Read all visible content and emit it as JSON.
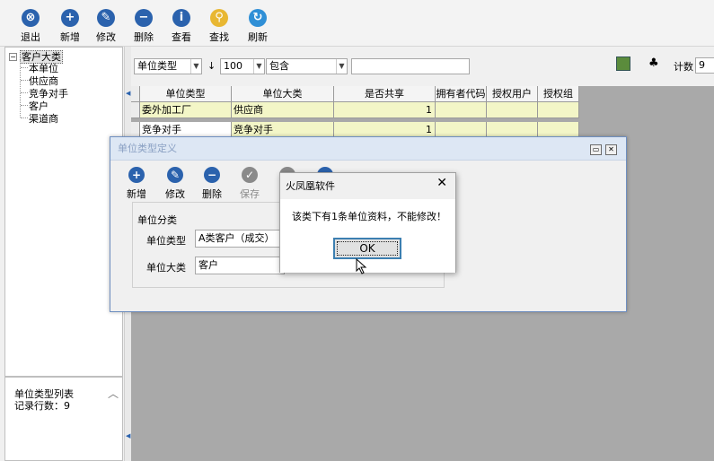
{
  "toolbar": {
    "buttons": [
      {
        "label": "退出",
        "icon": "exit-icon",
        "glyph": "⊗"
      },
      {
        "label": "新增",
        "icon": "add-icon",
        "glyph": "+"
      },
      {
        "label": "修改",
        "icon": "edit-icon",
        "glyph": "✎"
      },
      {
        "label": "删除",
        "icon": "delete-icon",
        "glyph": "−"
      },
      {
        "label": "查看",
        "icon": "view-icon",
        "glyph": "i"
      },
      {
        "label": "查找",
        "icon": "search-icon",
        "glyph": "⚲"
      },
      {
        "label": "刷新",
        "icon": "refresh-icon",
        "glyph": "↻"
      }
    ]
  },
  "tree": {
    "root": "客户大类",
    "expander": "−",
    "children": [
      "本单位",
      "供应商",
      "竞争对手",
      "客户",
      "渠道商"
    ]
  },
  "info": {
    "line1": "单位类型列表",
    "line2": "记录行数：9"
  },
  "filter": {
    "field": "单位类型",
    "sort_arrow": "↓",
    "limit": "100",
    "operator": "包含",
    "value": "",
    "count_label": "计数",
    "count_value": "9"
  },
  "grid": {
    "columns": [
      "单位类型",
      "单位大类",
      "是否共享",
      "拥有者代码",
      "授权用户",
      "授权组"
    ],
    "rows": [
      [
        "委外加工厂",
        "供应商",
        "1",
        "",
        "",
        ""
      ],
      [
        "竞争对手",
        "竞争对手",
        "1",
        "",
        "",
        ""
      ]
    ]
  },
  "dialog": {
    "title": "单位类型定义",
    "buttons": [
      {
        "label": "新增",
        "icon": "add-icon",
        "glyph": "+",
        "enabled": true
      },
      {
        "label": "修改",
        "icon": "edit-icon",
        "glyph": "✎",
        "enabled": true
      },
      {
        "label": "删除",
        "icon": "delete-icon",
        "glyph": "−",
        "enabled": true
      },
      {
        "label": "保存",
        "icon": "save-icon",
        "glyph": "✓",
        "enabled": false
      }
    ],
    "group_label": "单位分类",
    "type_label": "单位类型",
    "type_value": "A类客户（成交）",
    "category_label": "单位大类",
    "category_value": "客户"
  },
  "message": {
    "title": "火凤凰软件",
    "text": "该类下有1条单位资料，不能修改！",
    "ok": "OK",
    "close": "✕"
  },
  "colors": {
    "accent": "#2b62ad",
    "row_highlight": "#f3f6c7",
    "grid_background": "#a9a9a9"
  }
}
